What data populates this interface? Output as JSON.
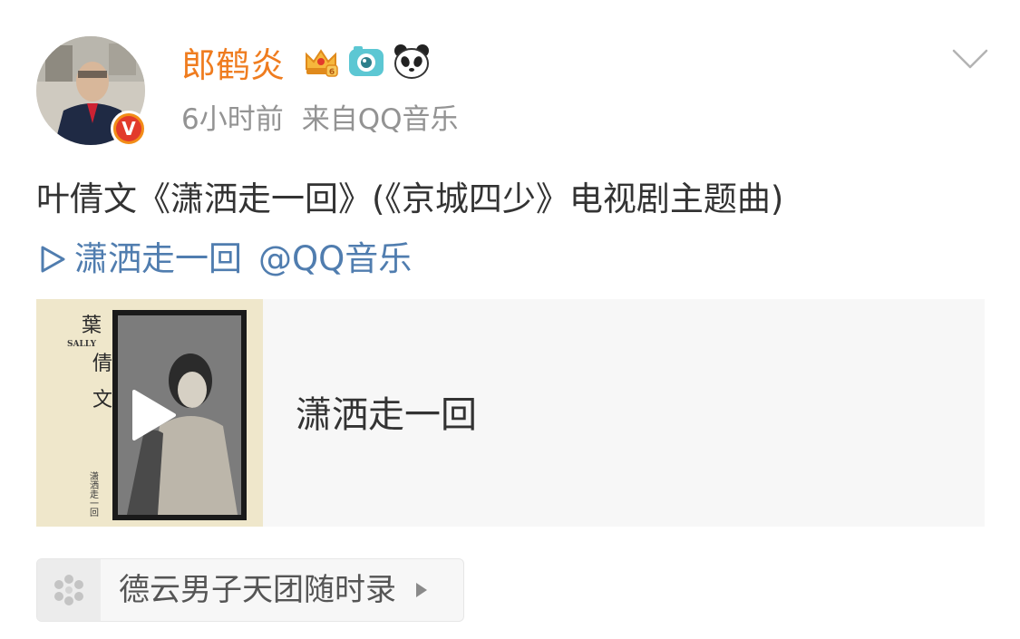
{
  "author": {
    "name": "郎鹤炎",
    "badges": [
      "crown-member-icon",
      "camera-icon",
      "panda-icon"
    ],
    "verified": "V"
  },
  "meta": {
    "time": "6小时前",
    "source": "来自QQ音乐"
  },
  "post": {
    "text": "叶倩文《潇洒走一回》(《京城四少》电视剧主题曲)",
    "song_link": "潇洒走一回",
    "mention": "@QQ音乐"
  },
  "music_card": {
    "title": "潇洒走一回",
    "album_caption": "葉倩文",
    "album_brand": "SALLY",
    "album_subtitle": "潇洒走一回"
  },
  "topic": {
    "label": "德云男子天团随时录"
  },
  "colors": {
    "username": "#ef7c1f",
    "link": "#507daf",
    "meta": "#939393",
    "text": "#333333"
  }
}
